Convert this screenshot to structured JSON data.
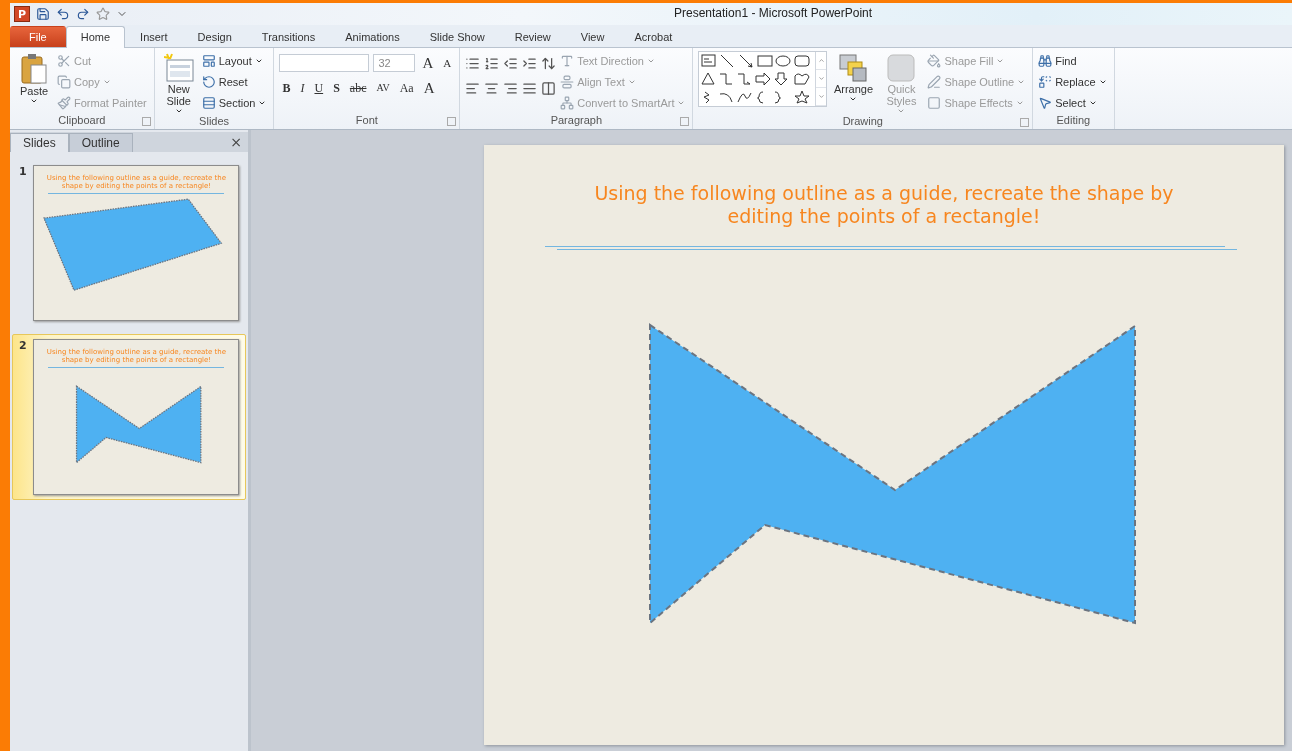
{
  "window": {
    "app_logo": "P",
    "title": "Presentation1  -  Microsoft PowerPoint"
  },
  "tabs": [
    {
      "label": "File",
      "kind": "backstage",
      "selected": false
    },
    {
      "label": "Home",
      "kind": "tab",
      "selected": true
    },
    {
      "label": "Insert",
      "kind": "tab",
      "selected": false
    },
    {
      "label": "Design",
      "kind": "tab",
      "selected": false
    },
    {
      "label": "Transitions",
      "kind": "tab",
      "selected": false
    },
    {
      "label": "Animations",
      "kind": "tab",
      "selected": false
    },
    {
      "label": "Slide Show",
      "kind": "tab",
      "selected": false
    },
    {
      "label": "Review",
      "kind": "tab",
      "selected": false
    },
    {
      "label": "View",
      "kind": "tab",
      "selected": false
    },
    {
      "label": "Acrobat",
      "kind": "tab",
      "selected": false
    }
  ],
  "ribbon": {
    "groups": [
      {
        "name": "Clipboard",
        "kind": "buttons",
        "launcher": true,
        "items": [
          {
            "kind": "large",
            "label": "Paste",
            "dropdown": true,
            "disabled": false
          },
          {
            "kind": "small",
            "label": "Cut",
            "dropdown": false,
            "disabled": true
          },
          {
            "kind": "small",
            "label": "Copy",
            "dropdown": true,
            "disabled": true
          },
          {
            "kind": "small",
            "label": "Format Painter",
            "dropdown": false,
            "disabled": true
          }
        ]
      },
      {
        "name": "Slides",
        "kind": "buttons",
        "launcher": false,
        "items": [
          {
            "kind": "large",
            "label": "New Slide",
            "dropdown": true,
            "disabled": false
          },
          {
            "kind": "small",
            "label": "Layout",
            "dropdown": true,
            "disabled": false
          },
          {
            "kind": "small",
            "label": "Reset",
            "dropdown": false,
            "disabled": false
          },
          {
            "kind": "small",
            "label": "Section",
            "dropdown": true,
            "disabled": false
          }
        ]
      },
      {
        "name": "Font",
        "kind": "font",
        "launcher": true,
        "font_size": "32",
        "grow": "A",
        "shrink": "A",
        "format_buttons": [
          "B",
          "I",
          "U",
          "S",
          "abc",
          "AV",
          "Aa",
          "A"
        ]
      },
      {
        "name": "Paragraph",
        "kind": "paragraph",
        "launcher": true,
        "items": [
          {
            "kind": "small",
            "label": "Text Direction",
            "dropdown": true,
            "disabled": true
          },
          {
            "kind": "small",
            "label": "Align Text",
            "dropdown": true,
            "disabled": true
          },
          {
            "kind": "small",
            "label": "Convert to SmartArt",
            "dropdown": true,
            "disabled": true
          }
        ]
      },
      {
        "name": "Drawing",
        "kind": "drawing",
        "launcher": true,
        "items": [
          {
            "kind": "large",
            "label": "Arrange",
            "dropdown": true,
            "disabled": false
          },
          {
            "kind": "large",
            "label": "Quick Styles",
            "dropdown": true,
            "disabled": true
          },
          {
            "kind": "small",
            "label": "Shape Fill",
            "dropdown": true,
            "disabled": true
          },
          {
            "kind": "small",
            "label": "Shape Outline",
            "dropdown": true,
            "disabled": true
          },
          {
            "kind": "small",
            "label": "Shape Effects",
            "dropdown": true,
            "disabled": true
          }
        ]
      },
      {
        "name": "Editing",
        "kind": "buttons",
        "launcher": false,
        "items": [
          {
            "kind": "small",
            "label": "Find",
            "dropdown": false,
            "disabled": false
          },
          {
            "kind": "small",
            "label": "Replace",
            "dropdown": true,
            "disabled": false
          },
          {
            "kind": "small",
            "label": "Select",
            "dropdown": true,
            "disabled": false
          }
        ]
      }
    ]
  },
  "pane": {
    "tabs": [
      {
        "label": "Slides",
        "selected": true
      },
      {
        "label": "Outline",
        "selected": false
      }
    ],
    "close": "×",
    "slides": [
      {
        "number": "1",
        "title": "Using the following outline as a guide, recreate the shape by editing the points of a rectangle!",
        "kind": "quad",
        "selected": false
      },
      {
        "number": "2",
        "title": "Using the following outline as a guide, recreate the shape by editing the points of a rectangle!",
        "kind": "bowtie",
        "selected": true
      }
    ]
  },
  "slide": {
    "title": "Using the following outline as a guide, recreate the shape by editing the points of a rectangle!",
    "kind": "bowtie"
  }
}
